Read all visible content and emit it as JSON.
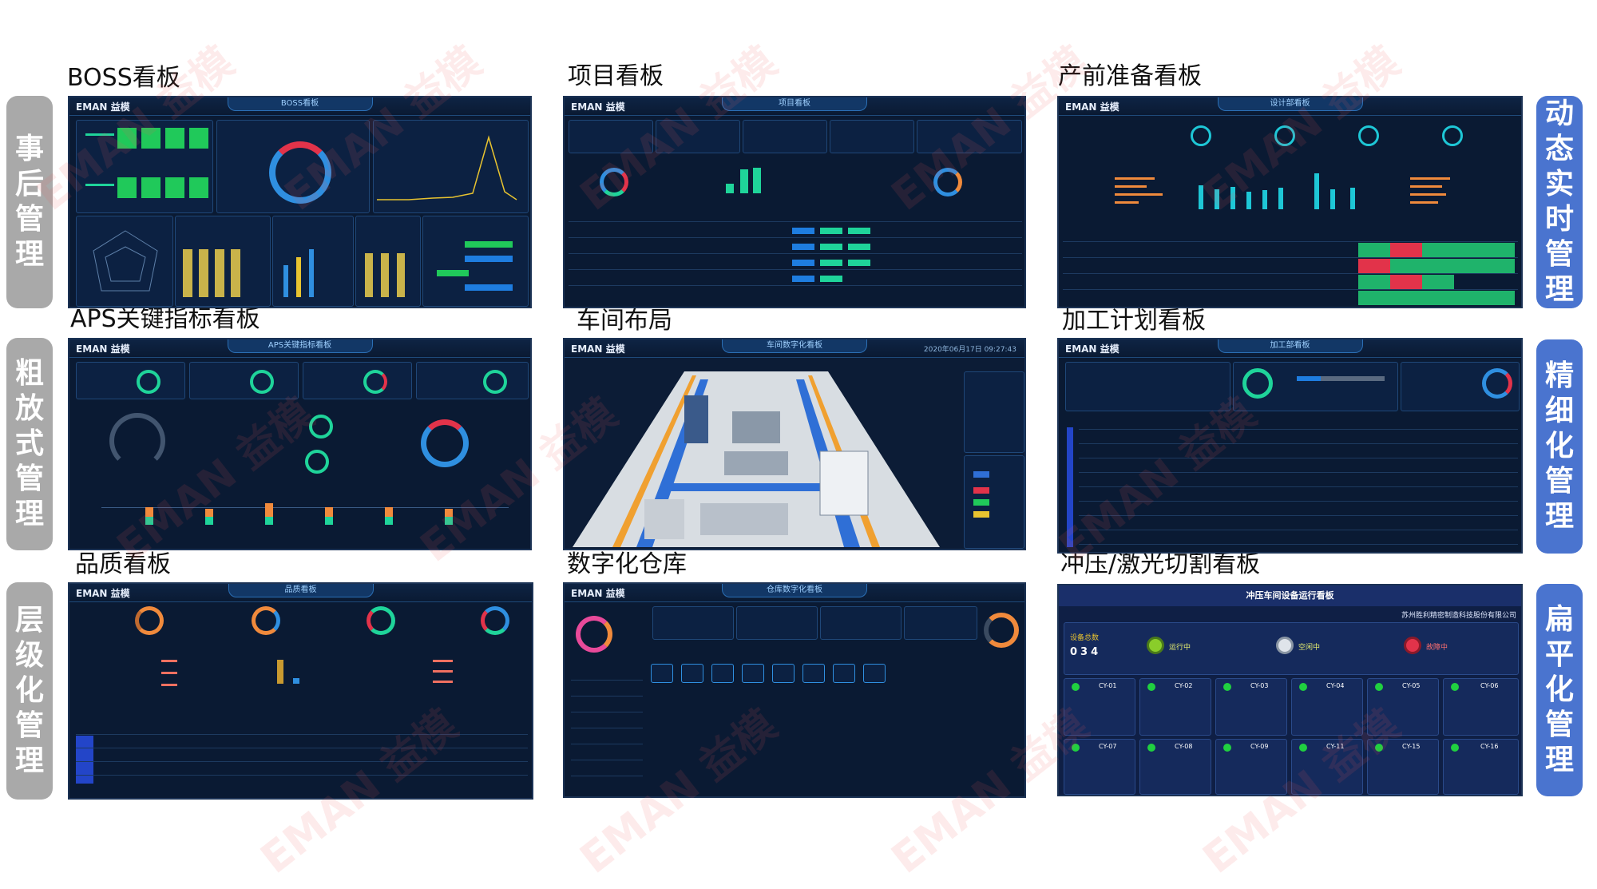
{
  "titles": {
    "boss": "BOSS看板",
    "project": "项目看板",
    "prep": "产前准备看板",
    "aps": "APS关键指标看板",
    "workshop": "车间布局",
    "machining": "加工计划看板",
    "quality": "品质看板",
    "warehouse": "数字化仓库",
    "stamping": "冲压/激光切割看板"
  },
  "left_labels": {
    "row1": [
      "事",
      "后",
      "管",
      "理"
    ],
    "row2": [
      "粗",
      "放",
      "式",
      "管",
      "理"
    ],
    "row3": [
      "层",
      "级",
      "化",
      "管",
      "理"
    ]
  },
  "right_labels": {
    "row1": [
      "动",
      "态",
      "实",
      "时",
      "管",
      "理"
    ],
    "row2": [
      "精",
      "细",
      "化",
      "管",
      "理"
    ],
    "row3": [
      "扁",
      "平",
      "化",
      "管",
      "理"
    ]
  },
  "panels": {
    "logo": "EMAN 益模",
    "boss_header": "BOSS看板",
    "project_header": "项目看板",
    "prep_header": "设计部看板",
    "aps_header": "APS关键指标看板",
    "workshop_header": "车间数字化看板",
    "workshop_time": "2020年06月17日 09:27:43",
    "machining_header": "加工部看板",
    "quality_header": "品质看板",
    "warehouse_header": "仓库数字化看板",
    "stamping_header": "冲压车间设备运行看板",
    "stamping_company": "苏州胜利精密制造科技股份有限公司",
    "stamping_total_label": "设备总数",
    "stamping_total": "034",
    "stamping_running": "运行中",
    "stamping_idle": "空闲中",
    "stamping_fault": "故障中",
    "stamping_devices": [
      "CY-01",
      "CY-02",
      "CY-03",
      "CY-04",
      "CY-05",
      "CY-06",
      "CY-07",
      "CY-08",
      "CY-09",
      "CY-11",
      "CY-15",
      "CY-16"
    ]
  },
  "colors": {
    "panel_bg": "#0a1a33",
    "gray_label": "#a9a9a9",
    "blue_label": "#4a74cf",
    "accent_green": "#1fd49a",
    "accent_cyan": "#1ec7d6",
    "accent_orange": "#f08a3c",
    "accent_red": "#e2334a"
  },
  "watermark": "EMAN 益模"
}
